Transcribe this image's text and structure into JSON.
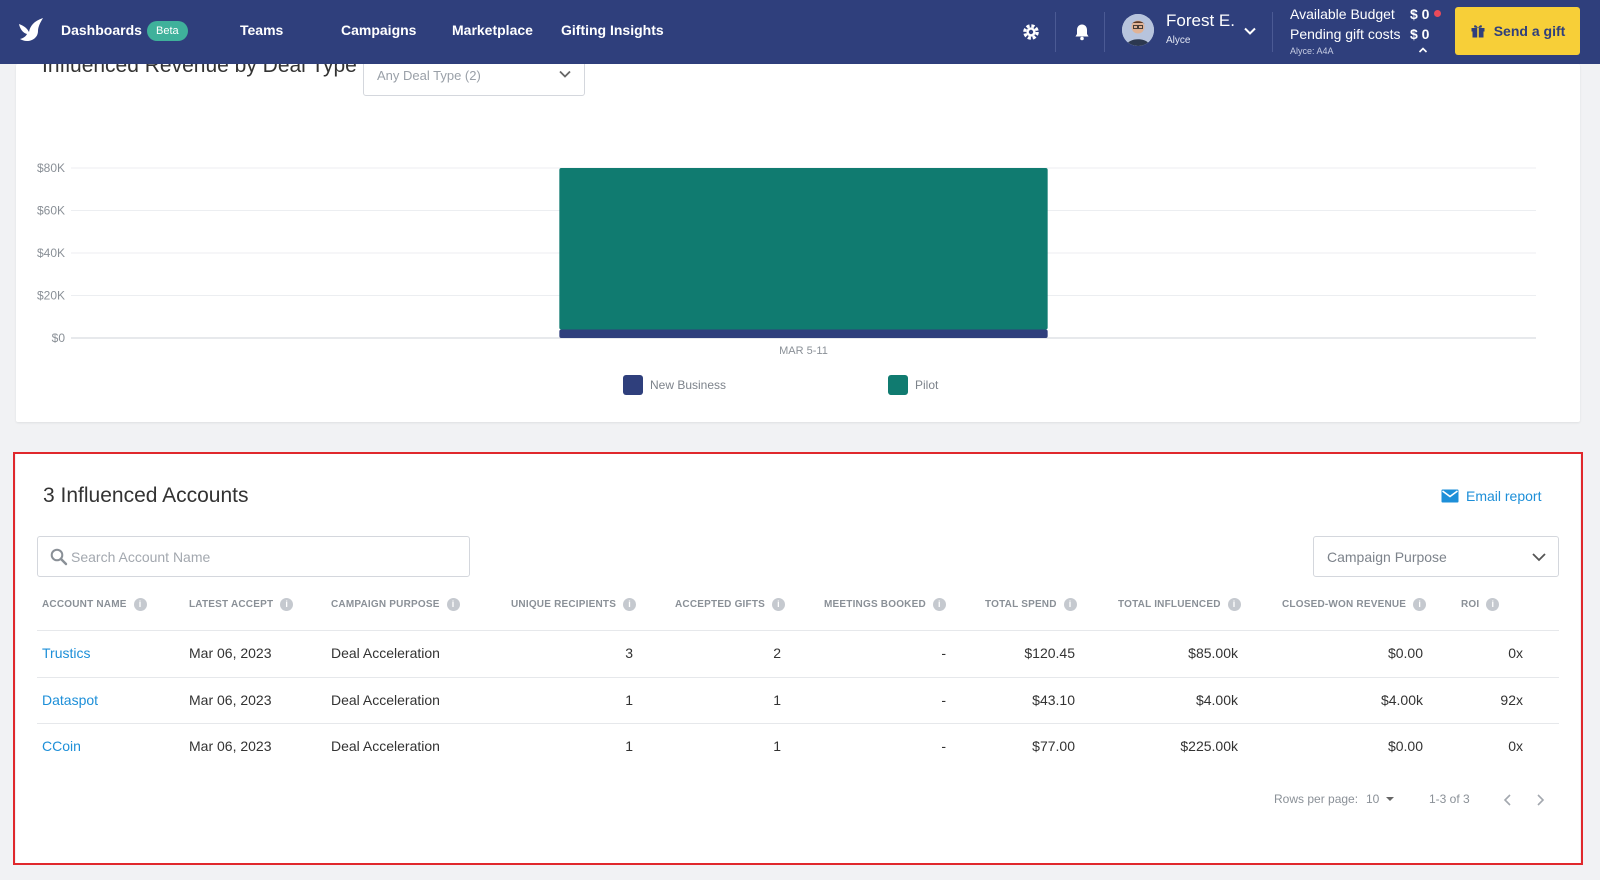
{
  "nav": {
    "items": [
      "Dashboards",
      "Teams",
      "Campaigns",
      "Marketplace",
      "Gifting Insights"
    ],
    "beta_label": "Beta",
    "user": {
      "name": "Forest E.",
      "org": "Alyce"
    },
    "budget": {
      "available_label": "Available Budget",
      "available_value": "$ 0",
      "pending_label": "Pending gift costs",
      "pending_value": "$ 0",
      "account": "Alyce: A4A"
    },
    "send_gift": "Send a gift",
    "colors": {
      "bar": "#2f3f7c",
      "accent": "#f7cf38",
      "beta": "#3fb19b"
    }
  },
  "chart_card": {
    "title": "Influenced Revenue by Deal Type",
    "deal_type_select": "Any Deal Type (2)"
  },
  "chart_data": {
    "type": "bar",
    "stacked": true,
    "categories": [
      "MAR 5-11"
    ],
    "series": [
      {
        "name": "New Business",
        "values": [
          4000
        ],
        "color": "#2f3f7c"
      },
      {
        "name": "Pilot",
        "values": [
          85000
        ],
        "color": "#107b70"
      }
    ],
    "yticks": [
      "$0",
      "$20K",
      "$40K",
      "$60K",
      "$80K"
    ],
    "ylim": [
      0,
      80000
    ],
    "grid": true,
    "legend": "bottom-center"
  },
  "accounts": {
    "title": "3 Influenced Accounts",
    "email_report": "Email report",
    "search_placeholder": "Search Account Name",
    "purpose_select": "Campaign Purpose",
    "columns": [
      "ACCOUNT NAME",
      "LATEST ACCEPT",
      "CAMPAIGN PURPOSE",
      "UNIQUE RECIPIENTS",
      "ACCEPTED GIFTS",
      "MEETINGS BOOKED",
      "TOTAL SPEND",
      "TOTAL INFLUENCED",
      "CLOSED-WON REVENUE",
      "ROI"
    ],
    "rows": [
      [
        "Trustics",
        "Mar 06, 2023",
        "Deal Acceleration",
        "3",
        "2",
        "-",
        "$120.45",
        "$85.00k",
        "$0.00",
        "0x"
      ],
      [
        "Dataspot",
        "Mar 06, 2023",
        "Deal Acceleration",
        "1",
        "1",
        "-",
        "$43.10",
        "$4.00k",
        "$4.00k",
        "92x"
      ],
      [
        "CCoin",
        "Mar 06, 2023",
        "Deal Acceleration",
        "1",
        "1",
        "-",
        "$77.00",
        "$225.00k",
        "$0.00",
        "0x"
      ]
    ],
    "pagination": {
      "rows_per_page_label": "Rows per page:",
      "rows_per_page": "10",
      "range": "1-3 of 3"
    }
  }
}
